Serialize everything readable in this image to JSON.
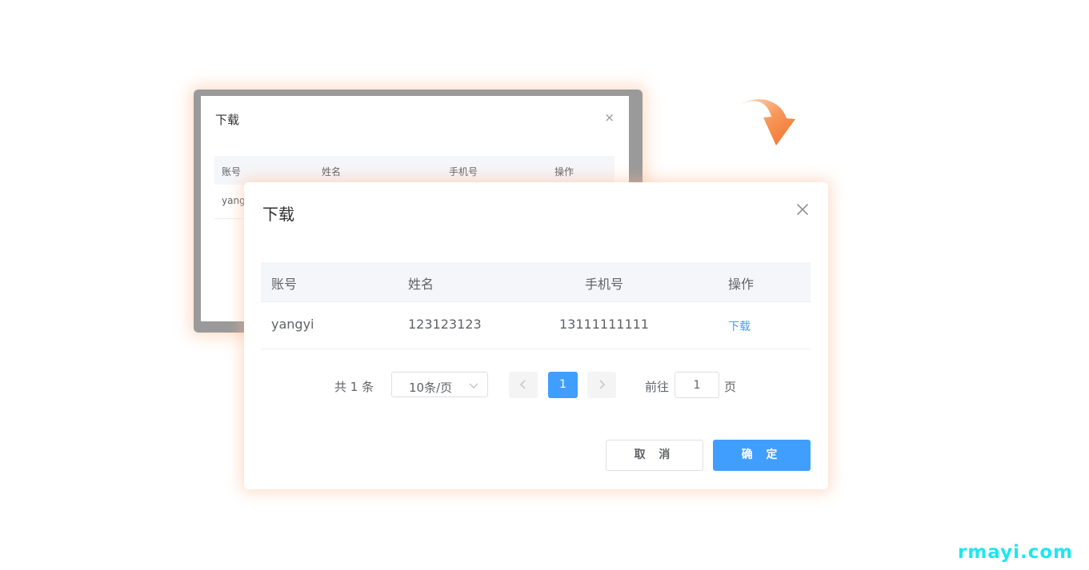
{
  "background_dialog": {
    "title": "下载",
    "close_glyph": "×",
    "columns": [
      "账号",
      "姓名",
      "手机号",
      "操作"
    ],
    "row_partial": "yang"
  },
  "arrow": {
    "icon": "curved-arrow-down-icon",
    "color": "#f5823f"
  },
  "dialog": {
    "title": "下载",
    "close_icon": "close-icon",
    "table": {
      "columns": [
        "账号",
        "姓名",
        "手机号",
        "操作"
      ],
      "rows": [
        {
          "account": "yangyi",
          "name": "123123123",
          "phone": "13111111111",
          "action": "下载"
        }
      ]
    },
    "pagination": {
      "total": "共 1 条",
      "page_size": "10条/页",
      "current_page": "1",
      "goto_label": "前往",
      "goto_value": "1",
      "goto_suffix": "页"
    },
    "buttons": {
      "cancel": "取 消",
      "confirm": "确 定"
    }
  },
  "colors": {
    "primary": "#409eff",
    "header_bg": "#f5f6f9",
    "arrow": "#f5823f",
    "watermark": "#1fe6f0"
  },
  "watermark": "rmayi.com"
}
